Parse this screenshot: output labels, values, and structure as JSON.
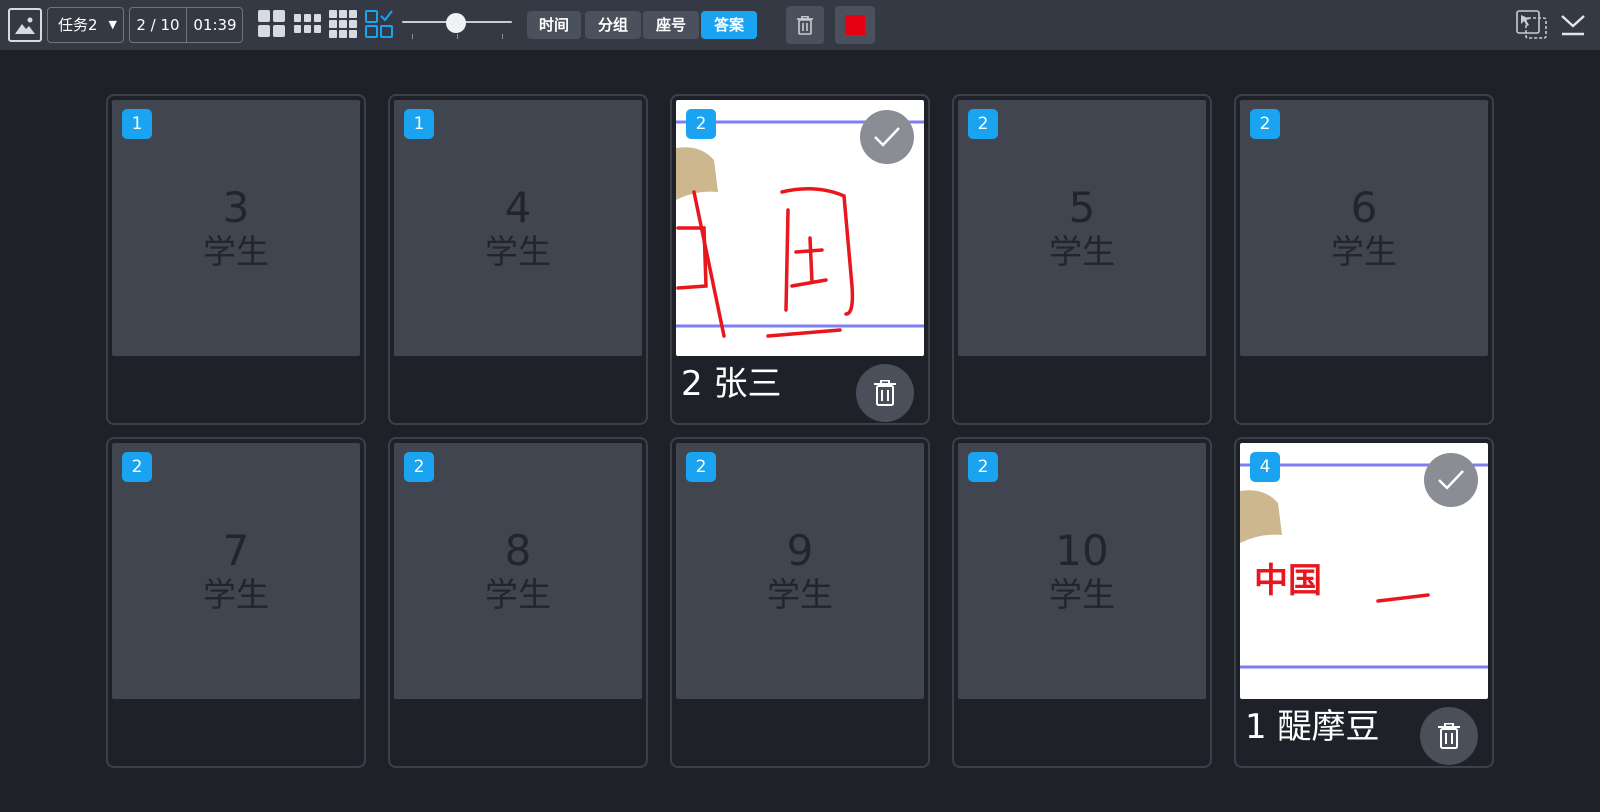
{
  "toolbar": {
    "task_select_value": "任务2",
    "progress": "2 / 10",
    "timer": "01:39",
    "sort_buttons": [
      "时间",
      "分组",
      "座号",
      "答案"
    ],
    "active_sort": "答案",
    "accent_color": "#1aa3f0",
    "stop_color": "#e60012",
    "zoom_level": 0.5
  },
  "cards": [
    {
      "badge": "1",
      "seat": "3",
      "role": "学生",
      "submitted": false
    },
    {
      "badge": "1",
      "seat": "4",
      "role": "学生",
      "submitted": false
    },
    {
      "badge": "2",
      "submitted": true,
      "name": "2 张三",
      "answer_text": "中国"
    },
    {
      "badge": "2",
      "seat": "5",
      "role": "学生",
      "submitted": false
    },
    {
      "badge": "2",
      "seat": "6",
      "role": "学生",
      "submitted": false
    },
    {
      "badge": "2",
      "seat": "7",
      "role": "学生",
      "submitted": false
    },
    {
      "badge": "2",
      "seat": "8",
      "role": "学生",
      "submitted": false
    },
    {
      "badge": "2",
      "seat": "9",
      "role": "学生",
      "submitted": false
    },
    {
      "badge": "2",
      "seat": "10",
      "role": "学生",
      "submitted": false
    },
    {
      "badge": "4",
      "submitted": true,
      "name": "1 醍摩豆",
      "answer_text": "中国"
    }
  ]
}
